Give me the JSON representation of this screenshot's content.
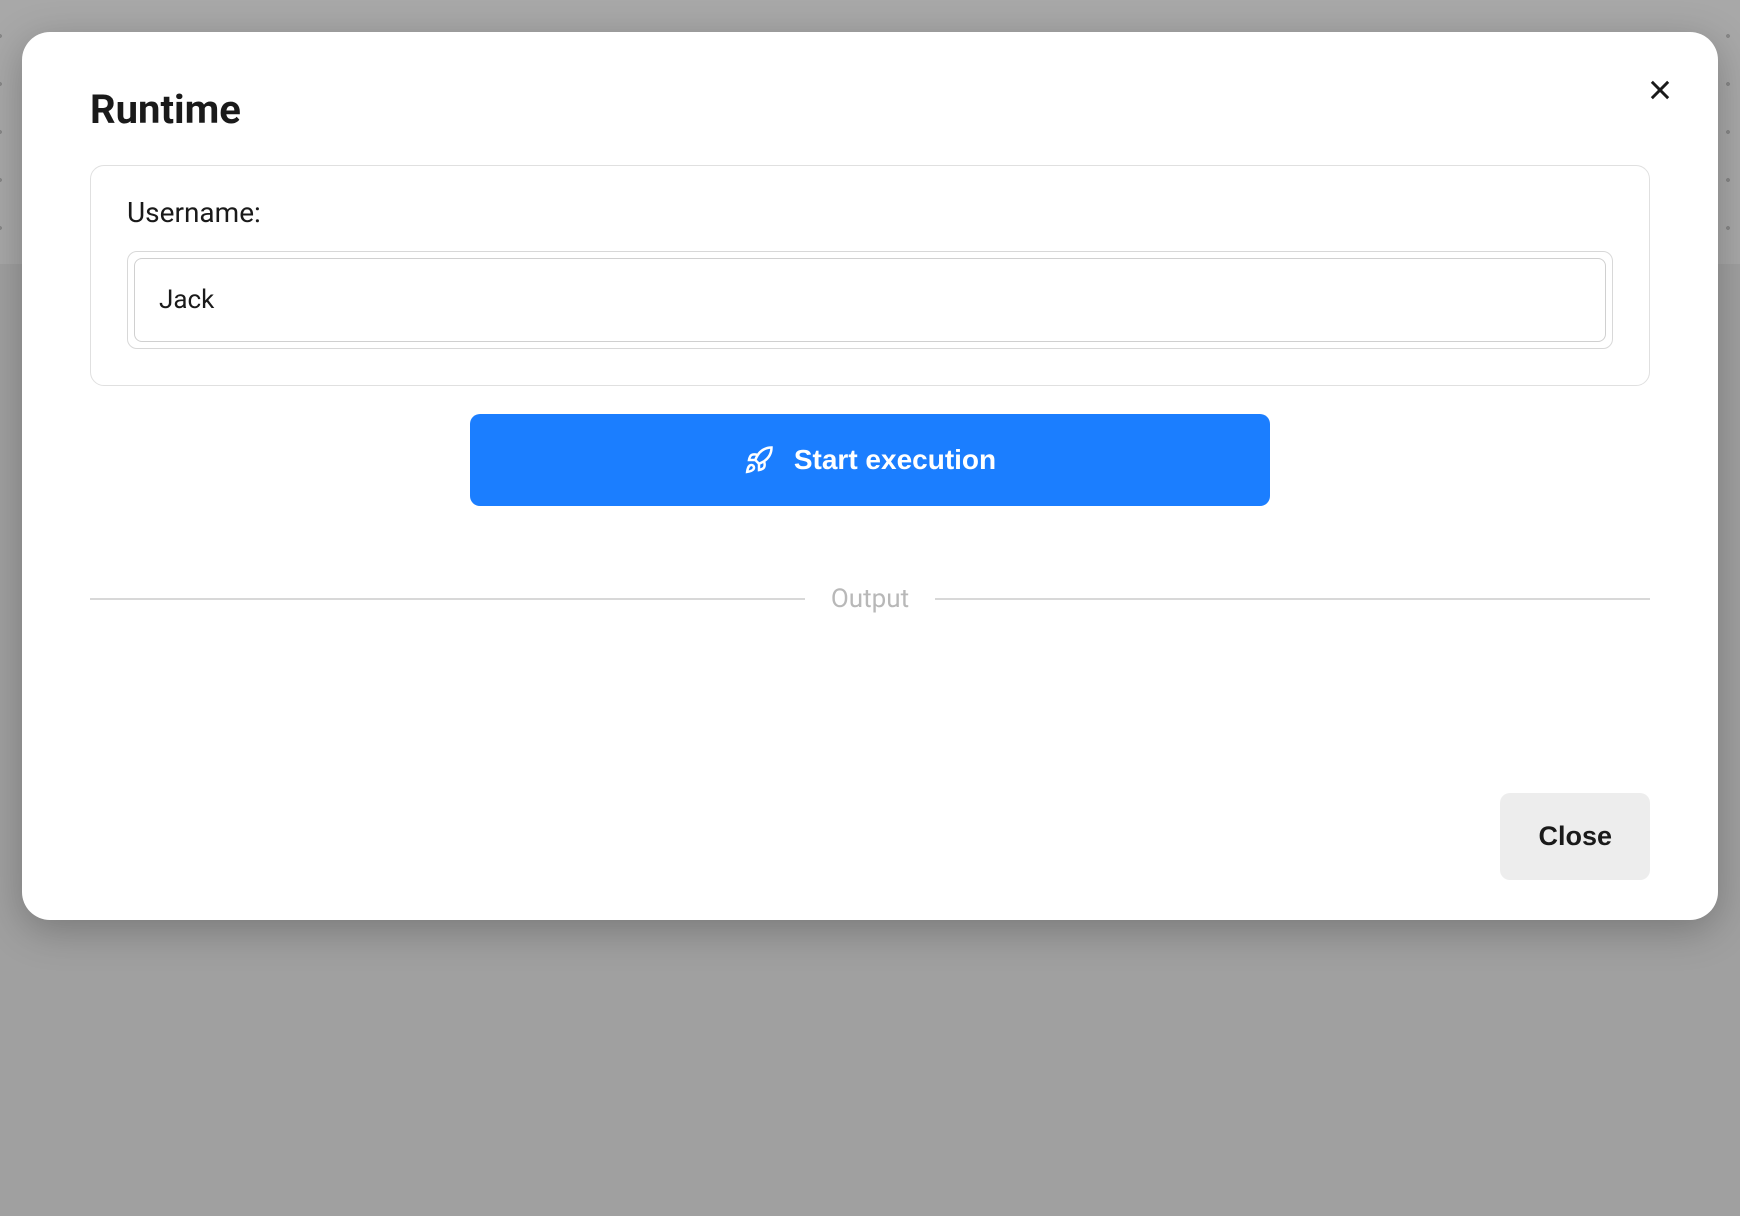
{
  "modal": {
    "title": "Runtime",
    "form": {
      "username_label": "Username:",
      "username_value": "Jack"
    },
    "start_button_label": "Start execution",
    "output_divider_label": "Output",
    "close_button_label": "Close"
  }
}
